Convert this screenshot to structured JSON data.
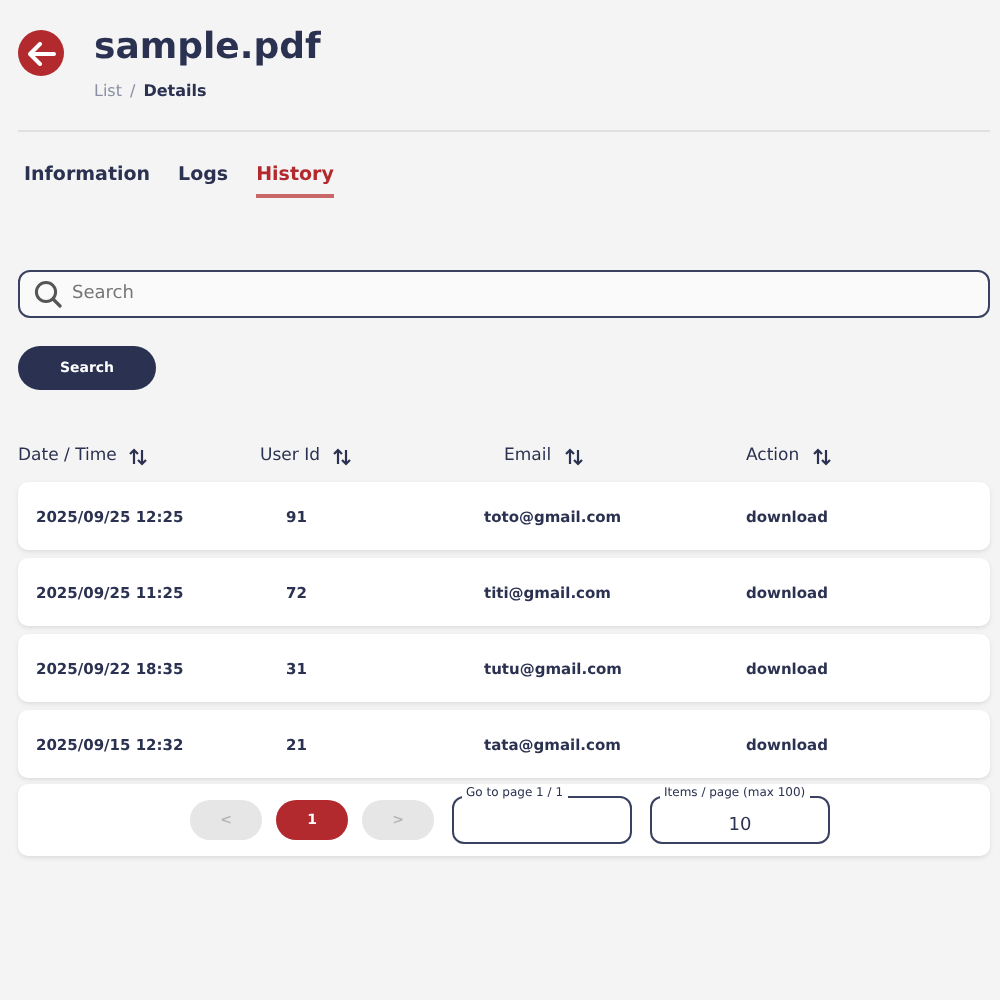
{
  "header": {
    "title": "sample.pdf",
    "breadcrumb": [
      {
        "label": "List",
        "current": false
      },
      {
        "label": "Details",
        "current": true
      }
    ],
    "separator": "/"
  },
  "tabs": [
    {
      "label": "Information",
      "selected": false
    },
    {
      "label": "Logs",
      "selected": false
    },
    {
      "label": "History",
      "selected": true
    }
  ],
  "search": {
    "placeholder": "Search",
    "button": "Search"
  },
  "table": {
    "columns": [
      "Date / Time",
      "User Id",
      "Email",
      "Action"
    ],
    "rows": [
      [
        "2025/09/25 12:25",
        "91",
        "toto@gmail.com",
        "download"
      ],
      [
        "2025/09/25 11:25",
        "72",
        "titi@gmail.com",
        "download"
      ],
      [
        "2025/09/22 18:35",
        "31",
        "tutu@gmail.com",
        "download"
      ],
      [
        "2025/09/15 12:32",
        "21",
        "tata@gmail.com",
        "download"
      ]
    ]
  },
  "pagination": {
    "prev": {
      "label": "<",
      "disabled": true
    },
    "pages": [
      {
        "label": "1",
        "selected": true
      }
    ],
    "next": {
      "label": ">",
      "disabled": true
    },
    "goto_label": "Go to page 1 / 1",
    "items_label": "Items / page (max 100)",
    "items_value": "10"
  }
}
